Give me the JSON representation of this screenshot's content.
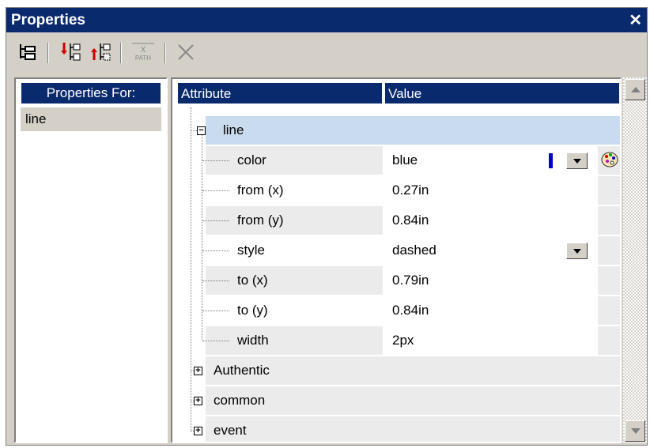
{
  "window": {
    "title": "Properties",
    "close_glyph": "✕"
  },
  "toolbar": {
    "buttons": [
      {
        "name": "tree-view-icon"
      },
      {
        "name": "insert-before-icon"
      },
      {
        "name": "insert-after-icon"
      },
      {
        "name": "xpath-icon",
        "label": "X",
        "sublabel": "PATH"
      },
      {
        "name": "delete-icon"
      }
    ]
  },
  "left_panel": {
    "header": "Properties For:",
    "items": [
      "line"
    ]
  },
  "table": {
    "headers": {
      "attribute": "Attribute",
      "value": "Value"
    },
    "group": {
      "name": "line",
      "expanded": true,
      "rows": [
        {
          "attribute": "color",
          "value": "blue",
          "has_dropdown": true,
          "has_palette": true,
          "swatch_color": "#0000cc"
        },
        {
          "attribute": "from (x)",
          "value": "0.27in"
        },
        {
          "attribute": "from (y)",
          "value": "0.84in"
        },
        {
          "attribute": "style",
          "value": "dashed",
          "has_dropdown": true
        },
        {
          "attribute": "to (x)",
          "value": "0.79in"
        },
        {
          "attribute": "to (y)",
          "value": "0.84in"
        },
        {
          "attribute": "width",
          "value": "2px"
        }
      ]
    },
    "collapsed_groups": [
      "Authentic",
      "common",
      "event"
    ]
  },
  "colors": {
    "title_bar": "#0a2a6e",
    "selected_group": "#c9dbee",
    "row_alt": "#ebebeb",
    "chrome": "#d4d0c8"
  }
}
